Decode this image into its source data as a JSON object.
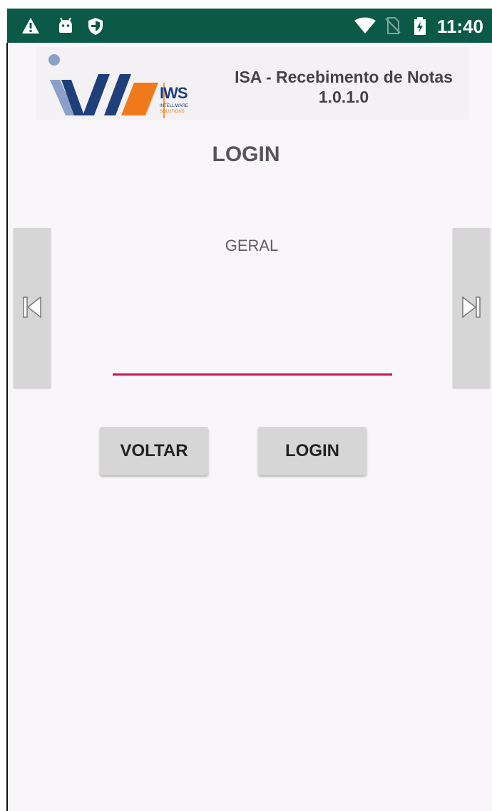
{
  "status_bar": {
    "time": "11:40",
    "icons": [
      "warning-icon",
      "android-icon",
      "shield-icon",
      "wifi-icon",
      "no-sim-icon",
      "battery-charging-icon"
    ]
  },
  "header": {
    "logo": {
      "brand": "IWS",
      "line1": "INTELLIWARE",
      "line2": "SOLUTIONS",
      "colors": {
        "blue": "#1f3f7a",
        "orange": "#f07a1a",
        "person": "#8aa0c6"
      }
    },
    "title": "ISA - Recebimento de Notas",
    "version": "1.0.1.0"
  },
  "page": {
    "heading": "LOGIN",
    "section_label": "GERAL",
    "field_value": "",
    "prev_button_icon": "skip-previous-icon",
    "next_button_icon": "skip-next-icon",
    "accent_color": "#c2185b"
  },
  "buttons": {
    "back_label": "VOLTAR",
    "login_label": "LOGIN"
  }
}
